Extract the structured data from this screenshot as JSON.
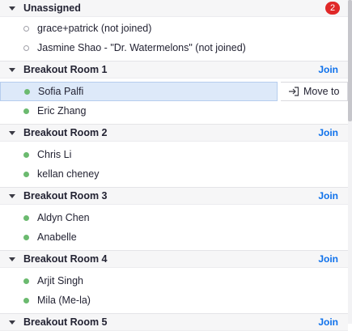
{
  "unassigned": {
    "title": "Unassigned",
    "count": "2",
    "members": [
      {
        "name": "grace+patrick (not joined)"
      },
      {
        "name": "Jasmine Shao - \"Dr. Watermelons\" (not joined)"
      }
    ]
  },
  "rooms": [
    {
      "title": "Breakout Room 1",
      "join_label": "Join",
      "members": [
        {
          "name": "Sofia Palfi"
        },
        {
          "name": "Eric Zhang"
        }
      ]
    },
    {
      "title": "Breakout Room 2",
      "join_label": "Join",
      "members": [
        {
          "name": "Chris Li"
        },
        {
          "name": "kellan cheney"
        }
      ]
    },
    {
      "title": "Breakout Room 3",
      "join_label": "Join",
      "members": [
        {
          "name": "Aldyn Chen"
        },
        {
          "name": "Anabelle"
        }
      ]
    },
    {
      "title": "Breakout Room 4",
      "join_label": "Join",
      "members": [
        {
          "name": "Arjit Singh"
        },
        {
          "name": "Mila (Me-la)"
        }
      ]
    },
    {
      "title": "Breakout Room 5",
      "join_label": "Join",
      "members": []
    }
  ],
  "move_to": {
    "label": "Move to"
  },
  "colors": {
    "join": "#0e71eb",
    "badge": "#e02828",
    "online": "#6bba6f",
    "selected": "#dde9f9"
  }
}
